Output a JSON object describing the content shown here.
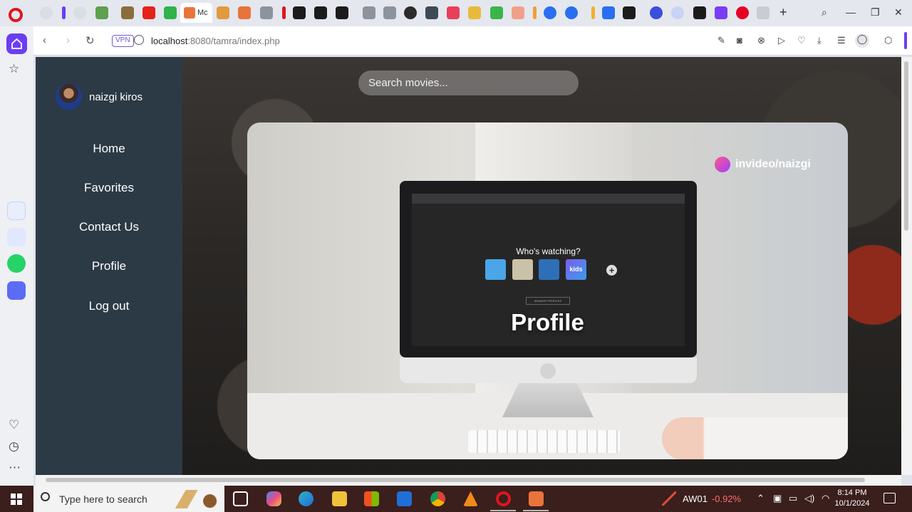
{
  "browser": {
    "active_tab_label": "Mc",
    "url_host": "localhost",
    "url_rest": ":8080/tamra/index.php",
    "vpn_label": "VPN"
  },
  "app": {
    "user_name": "naizgi kiros",
    "nav": [
      "Home",
      "Favorites",
      "Contact Us",
      "Profile",
      "Log out"
    ],
    "search_placeholder": "Search movies..."
  },
  "hero": {
    "badge": "invideo/naizgi",
    "screen_heading": "Who's watching?",
    "manage_label": "MANAGE PROFILES",
    "profile_tile_label": "kids",
    "title": "Profile"
  },
  "taskbar": {
    "search_placeholder": "Type here to search",
    "stock_ticker": "AW01",
    "stock_change": "-0.92%",
    "time": "8:14 PM",
    "date": "10/1/2024"
  },
  "colors": {
    "sidebar_bg": "#2c3a46",
    "opera_red": "#e0151f",
    "opera_purple": "#6b3df5",
    "taskbar_bg": "#3a1f1d",
    "stock_negative": "#ff6b6b"
  },
  "icons": [
    "opera-icon",
    "home-icon",
    "star-icon",
    "heart-icon",
    "history-icon",
    "more-icon",
    "back-icon",
    "forward-icon",
    "reload-icon",
    "globe-icon",
    "search-icon",
    "windows-start-icon"
  ]
}
